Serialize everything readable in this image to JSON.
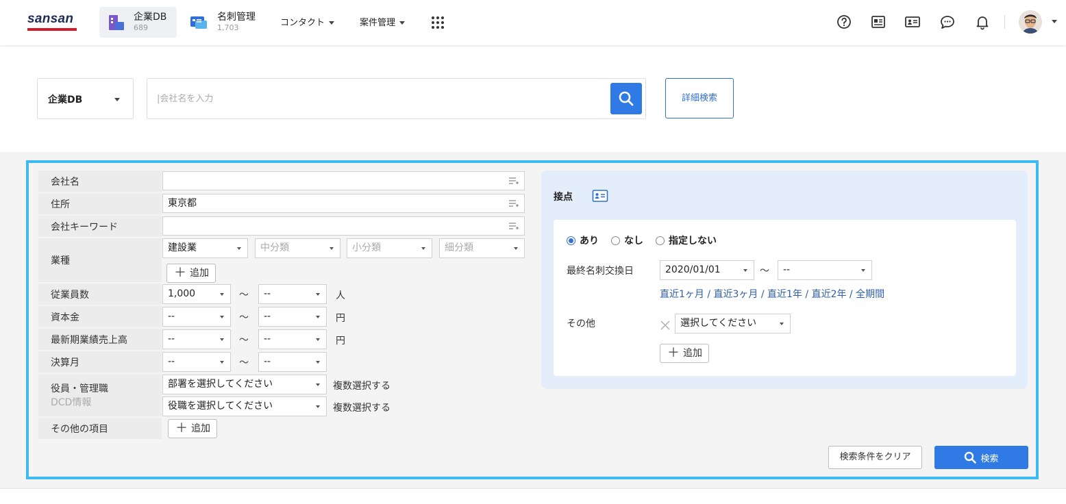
{
  "header": {
    "logo": "sansan",
    "apps": [
      {
        "label": "企業DB",
        "count": "689"
      },
      {
        "label": "名刺管理",
        "count": "1,703"
      }
    ],
    "menus": [
      "コンタクト",
      "案件管理"
    ],
    "icons": [
      "help-icon",
      "news-icon",
      "card-list-icon",
      "chat-icon",
      "bell-icon",
      "apps-grid-icon"
    ]
  },
  "search": {
    "scope": "企業DB",
    "placeholder": "|会社名を入力",
    "advanced_label": "詳細検索"
  },
  "form": {
    "company_name": {
      "label": "会社名",
      "value": ""
    },
    "address": {
      "label": "住所",
      "value": "東京都"
    },
    "keyword": {
      "label": "会社キーワード",
      "value": ""
    },
    "industry": {
      "label": "業種",
      "major": "建設業",
      "middle_placeholder": "中分類",
      "minor_placeholder": "小分類",
      "detail_placeholder": "細分類",
      "add_label": "追加"
    },
    "employees": {
      "label": "従業員数",
      "from": "1,000",
      "to": "--",
      "unit": "人"
    },
    "capital": {
      "label": "資本金",
      "from": "--",
      "to": "--",
      "unit": "円"
    },
    "sales": {
      "label": "最新期業績売上高",
      "from": "--",
      "to": "--",
      "unit": "円"
    },
    "fiscal_month": {
      "label": "決算月",
      "from": "--",
      "to": "--"
    },
    "executives": {
      "label": "役員・管理職",
      "sublabel": "DCD情報",
      "department_placeholder": "部署を選択してください",
      "position_placeholder": "役職を選択してください",
      "multi_label": "複数選択する"
    },
    "other_items": {
      "label": "その他の項目",
      "add_label": "追加"
    },
    "tilde": "〜"
  },
  "contact": {
    "title": "接点",
    "radios": [
      {
        "label": "あり",
        "selected": true
      },
      {
        "label": "なし",
        "selected": false
      },
      {
        "label": "指定しない",
        "selected": false
      }
    ],
    "last_exchange": {
      "label": "最終名刺交換日",
      "from": "2020/01/01",
      "to": "--"
    },
    "quick_links": "直近1ヶ月 / 直近3ヶ月 / 直近1年 / 直近2年 / 全期間",
    "other": {
      "label": "その他",
      "placeholder": "選択してください",
      "add_label": "追加"
    }
  },
  "actions": {
    "clear_label": "検索条件をクリア",
    "search_label": "検索"
  },
  "colors": {
    "accent": "#2f7ae5",
    "highlight_border": "#3ebaf0",
    "logo_red": "#d11a2a",
    "logo_navy": "#1c2b57"
  }
}
